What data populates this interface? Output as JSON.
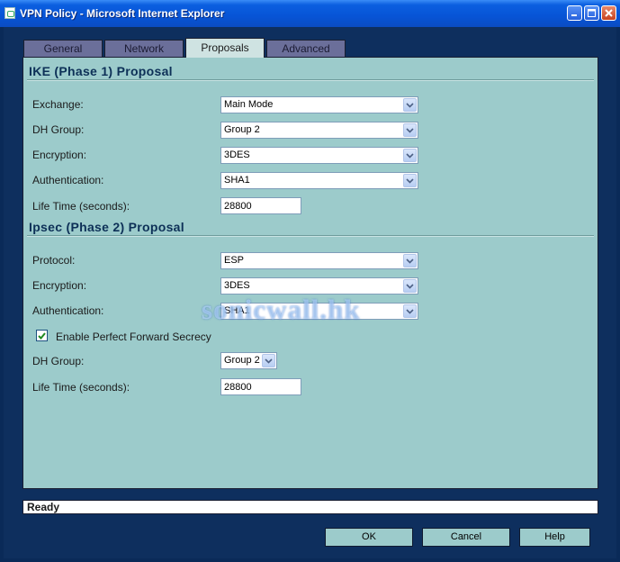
{
  "window": {
    "title": "VPN Policy - Microsoft Internet Explorer"
  },
  "tabs": [
    {
      "label": "General"
    },
    {
      "label": "Network"
    },
    {
      "label": "Proposals",
      "active": true
    },
    {
      "label": "Advanced"
    }
  ],
  "ike": {
    "title": "IKE (Phase 1) Proposal",
    "exchange": {
      "label": "Exchange:",
      "value": "Main Mode"
    },
    "dh_group": {
      "label": "DH Group:",
      "value": "Group 2"
    },
    "encryption": {
      "label": "Encryption:",
      "value": "3DES"
    },
    "authentication": {
      "label": "Authentication:",
      "value": "SHA1"
    },
    "lifetime": {
      "label": "Life Time (seconds):",
      "value": "28800"
    }
  },
  "ipsec": {
    "title": "Ipsec (Phase 2) Proposal",
    "protocol": {
      "label": "Protocol:",
      "value": "ESP"
    },
    "encryption": {
      "label": "Encryption:",
      "value": "3DES"
    },
    "authentication": {
      "label": "Authentication:",
      "value": "SHA1"
    },
    "pfs": {
      "label": "Enable Perfect Forward Secrecy",
      "checked": true
    },
    "dh_group": {
      "label": "DH Group:",
      "value": "Group 2"
    },
    "lifetime": {
      "label": "Life Time (seconds):",
      "value": "28800"
    }
  },
  "watermark": "sonicwall.hk",
  "status": "Ready",
  "buttons": {
    "ok": "OK",
    "cancel": "Cancel",
    "help": "Help"
  }
}
